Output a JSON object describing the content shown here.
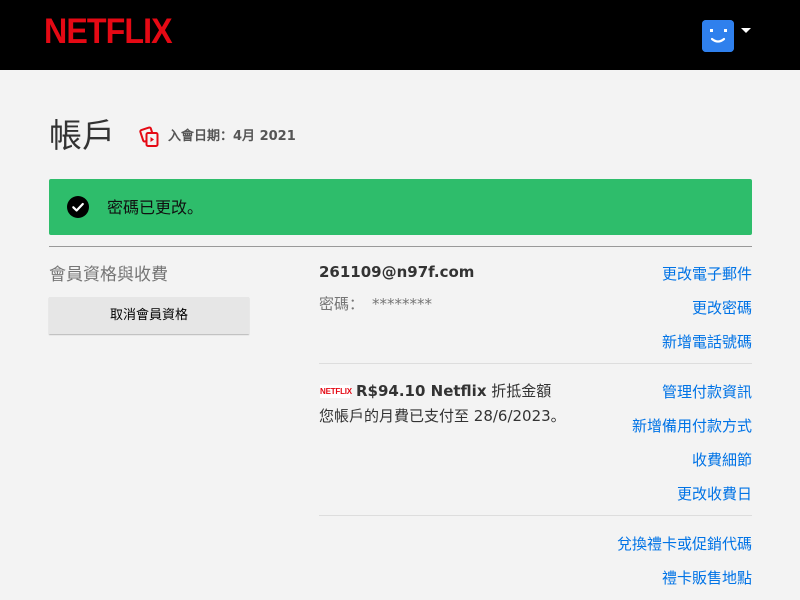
{
  "header": {
    "brand": "NETFLIX",
    "avatar_icon": "smiley-avatar-icon",
    "menu_caret_icon": "caret-down-icon"
  },
  "page": {
    "title": "帳戶",
    "member_since": "入會日期：4月 2021"
  },
  "alert": {
    "message": "密碼已更改。",
    "icon": "check-circle-icon",
    "color": "#2ebd6b"
  },
  "membership": {
    "section_title": "會員資格與收費",
    "cancel_button": "取消會員資格",
    "email": "261109@n97f.com",
    "password_label": "密碼：",
    "password_value": "********",
    "links": {
      "change_email": "更改電子郵件",
      "change_password": "更改密碼",
      "add_phone": "新增電話號碼"
    }
  },
  "billing": {
    "plan_logo": "NETFLIX",
    "price": "R$94.10 Netflix",
    "price_suffix": "折抵金額",
    "paid_until": "您帳戶的月費已支付至 28/6/2023。",
    "links": {
      "manage_payment": "管理付款資訊",
      "add_backup_payment": "新增備用付款方式",
      "billing_details": "收費細節",
      "change_billing_date": "更改收費日"
    }
  },
  "gift": {
    "links": {
      "redeem_gift": "兌換禮卡或促銷代碼",
      "gift_card_retailers": "禮卡販售地點"
    }
  },
  "colors": {
    "brand_red": "#e50914",
    "link_blue": "#0073e6",
    "avatar_blue": "#2f80ed"
  }
}
